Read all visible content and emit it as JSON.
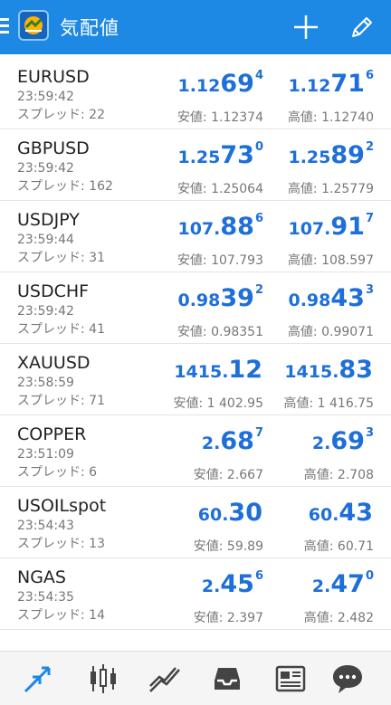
{
  "header": {
    "title": "気配値"
  },
  "colors": {
    "accent": "#1e88e5",
    "price": "#1e6fd9",
    "secondary_text": "#777777"
  },
  "quotes": [
    {
      "symbol": "EURUSD",
      "time": "23:59:42",
      "spread": "スプレッド: 22",
      "bid": {
        "p1": "1.12",
        "p2": "69",
        "p3": "4"
      },
      "ask": {
        "p1": "1.12",
        "p2": "71",
        "p3": "6"
      },
      "low": "安値: 1.12374",
      "high": "高値: 1.12740"
    },
    {
      "symbol": "GBPUSD",
      "time": "23:59:42",
      "spread": "スプレッド: 162",
      "bid": {
        "p1": "1.25",
        "p2": "73",
        "p3": "0"
      },
      "ask": {
        "p1": "1.25",
        "p2": "89",
        "p3": "2"
      },
      "low": "安値: 1.25064",
      "high": "高値: 1.25779"
    },
    {
      "symbol": "USDJPY",
      "time": "23:59:44",
      "spread": "スプレッド: 31",
      "bid": {
        "p1": "107.",
        "p2": "88",
        "p3": "6"
      },
      "ask": {
        "p1": "107.",
        "p2": "91",
        "p3": "7"
      },
      "low": "安値: 107.793",
      "high": "高値: 108.597"
    },
    {
      "symbol": "USDCHF",
      "time": "23:59:42",
      "spread": "スプレッド: 41",
      "bid": {
        "p1": "0.98",
        "p2": "39",
        "p3": "2"
      },
      "ask": {
        "p1": "0.98",
        "p2": "43",
        "p3": "3"
      },
      "low": "安値: 0.98351",
      "high": "高値: 0.99071"
    },
    {
      "symbol": "XAUUSD",
      "time": "23:58:59",
      "spread": "スプレッド: 71",
      "bid": {
        "p1": "1415.",
        "p2": "12",
        "p3": ""
      },
      "ask": {
        "p1": "1415.",
        "p2": "83",
        "p3": ""
      },
      "low": "安値: 1 402.95",
      "high": "高値: 1 416.75"
    },
    {
      "symbol": "COPPER",
      "time": "23:51:09",
      "spread": "スプレッド: 6",
      "bid": {
        "p1": "2.",
        "p2": "68",
        "p3": "7"
      },
      "ask": {
        "p1": "2.",
        "p2": "69",
        "p3": "3"
      },
      "low": "安値: 2.667",
      "high": "高値: 2.708"
    },
    {
      "symbol": "USOILspot",
      "time": "23:54:43",
      "spread": "スプレッド: 13",
      "bid": {
        "p1": "60.",
        "p2": "30",
        "p3": ""
      },
      "ask": {
        "p1": "60.",
        "p2": "43",
        "p3": ""
      },
      "low": "安値: 59.89",
      "high": "高値: 60.71"
    },
    {
      "symbol": "NGAS",
      "time": "23:54:35",
      "spread": "スプレッド: 14",
      "bid": {
        "p1": "2.",
        "p2": "45",
        "p3": "6"
      },
      "ask": {
        "p1": "2.",
        "p2": "47",
        "p3": "0"
      },
      "low": "安値: 2.397",
      "high": "高値: 2.482"
    }
  ],
  "bottom_nav": [
    {
      "icon": "quotes-arrows-icon",
      "active": true
    },
    {
      "icon": "candlestick-chart-icon",
      "active": false
    },
    {
      "icon": "trade-trend-icon",
      "active": false
    },
    {
      "icon": "inbox-tray-icon",
      "active": false
    },
    {
      "icon": "news-icon",
      "active": false
    },
    {
      "icon": "chat-bubble-icon",
      "active": false
    }
  ]
}
